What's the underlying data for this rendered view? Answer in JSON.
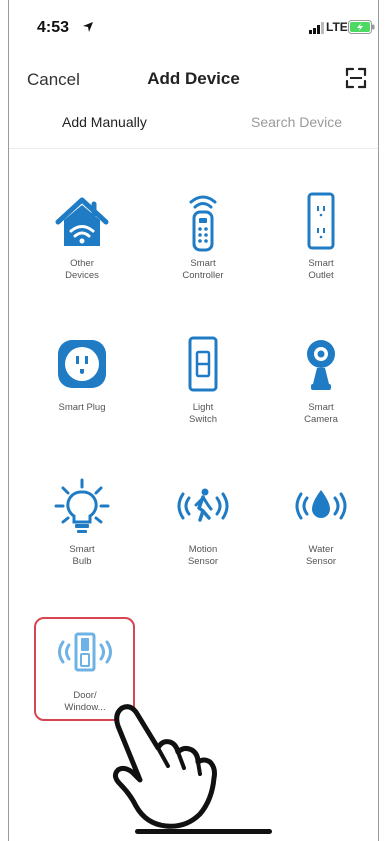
{
  "status_bar": {
    "time": "4:53",
    "network": "LTE"
  },
  "nav": {
    "cancel": "Cancel",
    "title": "Add Device"
  },
  "tabs": [
    {
      "label": "Add Manually",
      "active": true
    },
    {
      "label": "Search Device",
      "active": false
    }
  ],
  "devices": [
    {
      "label": "Other\nDevices",
      "icon": "house-wifi-icon"
    },
    {
      "label": "Smart\nController",
      "icon": "remote-control-icon"
    },
    {
      "label": "Smart\nOutlet",
      "icon": "wall-outlet-icon"
    },
    {
      "label": "Smart Plug",
      "icon": "smart-plug-icon"
    },
    {
      "label": "Light\nSwitch",
      "icon": "light-switch-icon"
    },
    {
      "label": "Smart\nCamera",
      "icon": "camera-icon"
    },
    {
      "label": "Smart\nBulb",
      "icon": "bulb-icon"
    },
    {
      "label": "Motion\nSensor",
      "icon": "motion-sensor-icon"
    },
    {
      "label": "Water\nSensor",
      "icon": "water-sensor-icon"
    },
    {
      "label": "Door/\nWindow...",
      "icon": "door-sensor-icon"
    }
  ],
  "colors": {
    "accent": "#1f7cc4",
    "accent_light": "#6fb3e6",
    "highlight": "#d64550",
    "inactive_text": "#9a9a9a"
  }
}
